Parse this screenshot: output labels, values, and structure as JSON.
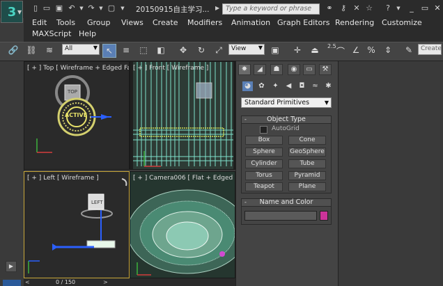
{
  "title_bar": {
    "document_title": "20150915自主学习...",
    "search_placeholder": "Type a keyword or phrase"
  },
  "menu": {
    "row1": [
      "Edit",
      "Tools",
      "Group",
      "Views",
      "Create",
      "Modifiers",
      "Animation",
      "Graph Editors",
      "Rendering",
      "Customize"
    ],
    "row2": [
      "MAXScript",
      "Help"
    ]
  },
  "toolbar": {
    "selection_filter": "All",
    "reference_coord": "View",
    "snap_label": "2.5",
    "create_selection_placeholder": "Create"
  },
  "viewports": {
    "top": "[ + ] Top [ Wireframe + Edged Faces ]",
    "front": "[ + ] Front [ Wireframe ]",
    "left": "[ + ] Left [ Wireframe ]",
    "camera": "[ + ] Camera006 [ Flat + Edged Faces ]",
    "viewcube_top": "TOP",
    "viewcube_left": "LEFT",
    "active_text": "ACTIVE"
  },
  "command_panel": {
    "primitive_type": "Standard Primitives",
    "object_type_title": "Object Type",
    "autogrid_label": "AutoGrid",
    "buttons": [
      "Box",
      "Cone",
      "Sphere",
      "GeoSphere",
      "Cylinder",
      "Tube",
      "Torus",
      "Pyramid",
      "Teapot",
      "Plane"
    ],
    "name_color_title": "Name and Color",
    "object_color": "#cc3399"
  },
  "timeline": {
    "frame_readout": "0 / 150"
  }
}
